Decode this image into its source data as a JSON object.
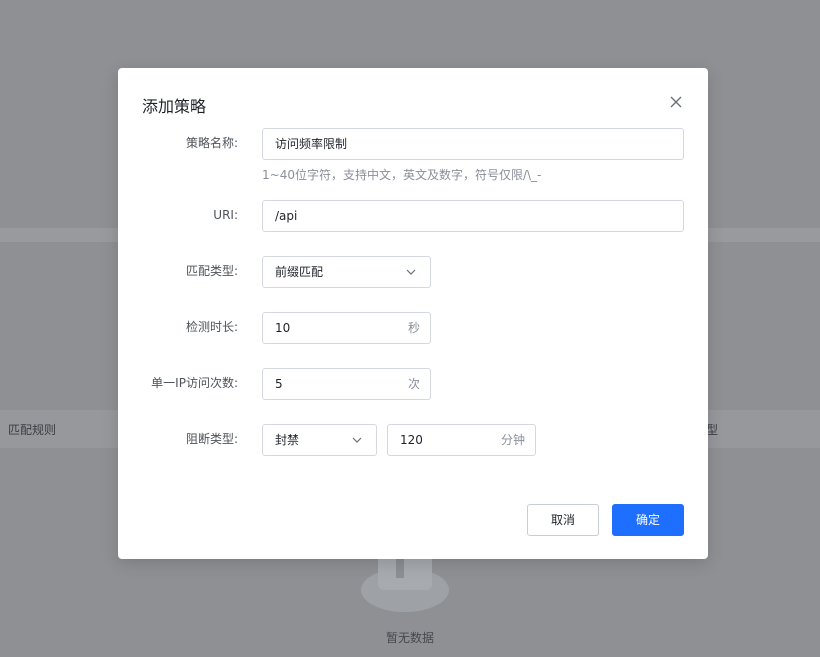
{
  "background": {
    "table_header_left": "匹配规则",
    "table_header_right": "型",
    "empty_text": "暂无数据"
  },
  "dialog": {
    "title": "添加策略",
    "name_field": {
      "label": "策略名称:",
      "value": "访问频率限制",
      "hint": "1~40位字符，支持中文，英文及数字，符号仅限/\\_-"
    },
    "uri_field": {
      "label": "URI:",
      "value": "/api"
    },
    "match_type_field": {
      "label": "匹配类型:",
      "value": "前缀匹配"
    },
    "duration_field": {
      "label": "检测时长:",
      "value": "10",
      "unit": "秒"
    },
    "count_field": {
      "label": "单一IP访问次数:",
      "value": "5",
      "unit": "次"
    },
    "block_field": {
      "label": "阻断类型:",
      "type_value": "封禁",
      "duration_value": "120",
      "duration_unit": "分钟"
    },
    "cancel_label": "取消",
    "ok_label": "确定"
  },
  "colors": {
    "primary": "#1e6fff",
    "overlay": "#8e9094"
  }
}
